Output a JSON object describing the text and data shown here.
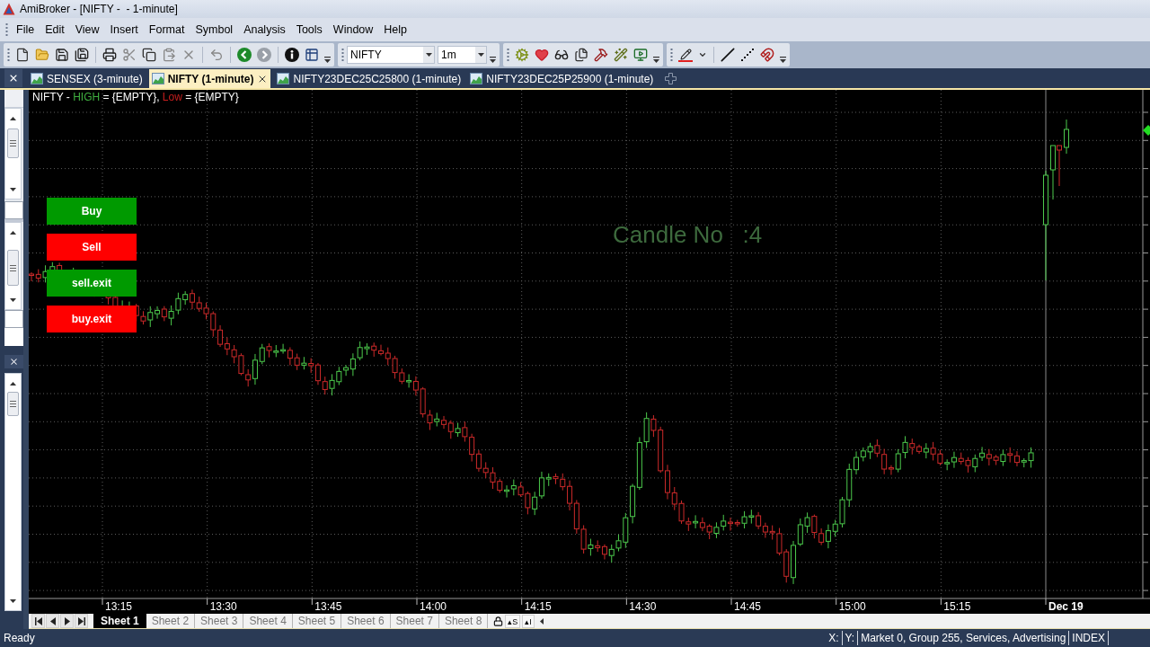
{
  "window": {
    "title": "AmiBroker - [NIFTY -  - 1-minute]"
  },
  "menu": [
    "File",
    "Edit",
    "View",
    "Insert",
    "Format",
    "Symbol",
    "Analysis",
    "Tools",
    "Window",
    "Help"
  ],
  "toolbar": {
    "symbol": "NIFTY",
    "interval": "1m"
  },
  "tabs": [
    {
      "label": "SENSEX (3-minute)",
      "selected": false
    },
    {
      "label": "NIFTY (1-minute)",
      "selected": true
    },
    {
      "label": "NIFTY23DEC25C25800 (1-minute)",
      "selected": false
    },
    {
      "label": "NIFTY23DEC25P25900 (1-minute)",
      "selected": false
    }
  ],
  "chart": {
    "title": [
      {
        "text": "NIFTY - "
      },
      {
        "text": "HIGH",
        "color": "#3fae3f"
      },
      {
        "text": " = {EMPTY}, "
      },
      {
        "text": "Low",
        "color": "#c81e1e"
      },
      {
        "text": " = {EMPTY}"
      }
    ],
    "buttons": [
      {
        "label": "Buy",
        "color": "#009a00"
      },
      {
        "label": "Sell",
        "color": "#ff0000"
      },
      {
        "label": "sell.exit",
        "color": "#009a00"
      },
      {
        "label": "buy.exit",
        "color": "#ff0000"
      }
    ],
    "candle_counter": "Candle No   :4",
    "time_axis": [
      {
        "text": "13:15",
        "kind": "time"
      },
      {
        "text": "13:30",
        "kind": "time"
      },
      {
        "text": "13:45",
        "kind": "time"
      },
      {
        "text": "14:00",
        "kind": "time"
      },
      {
        "text": "14:15",
        "kind": "time"
      },
      {
        "text": "14:30",
        "kind": "time"
      },
      {
        "text": "14:45",
        "kind": "time"
      },
      {
        "text": "15:00",
        "kind": "time"
      },
      {
        "text": "15:15",
        "kind": "time"
      },
      {
        "text": "Dec 19",
        "kind": "day"
      }
    ]
  },
  "sheets": [
    {
      "label": "Sheet 1",
      "selected": true
    },
    {
      "label": "Sheet 2",
      "selected": false
    },
    {
      "label": "Sheet 3",
      "selected": false
    },
    {
      "label": "Sheet 4",
      "selected": false
    },
    {
      "label": "Sheet 5",
      "selected": false
    },
    {
      "label": "Sheet 6",
      "selected": false
    },
    {
      "label": "Sheet 7",
      "selected": false
    },
    {
      "label": "Sheet 8",
      "selected": false
    }
  ],
  "sheet_tools": [
    "▴S",
    "▴I"
  ],
  "status_bar": {
    "message": "Ready",
    "panes": [
      "X:",
      "Y:",
      "Market 0, Group 255, Services, Advertising",
      "INDEX"
    ]
  }
}
